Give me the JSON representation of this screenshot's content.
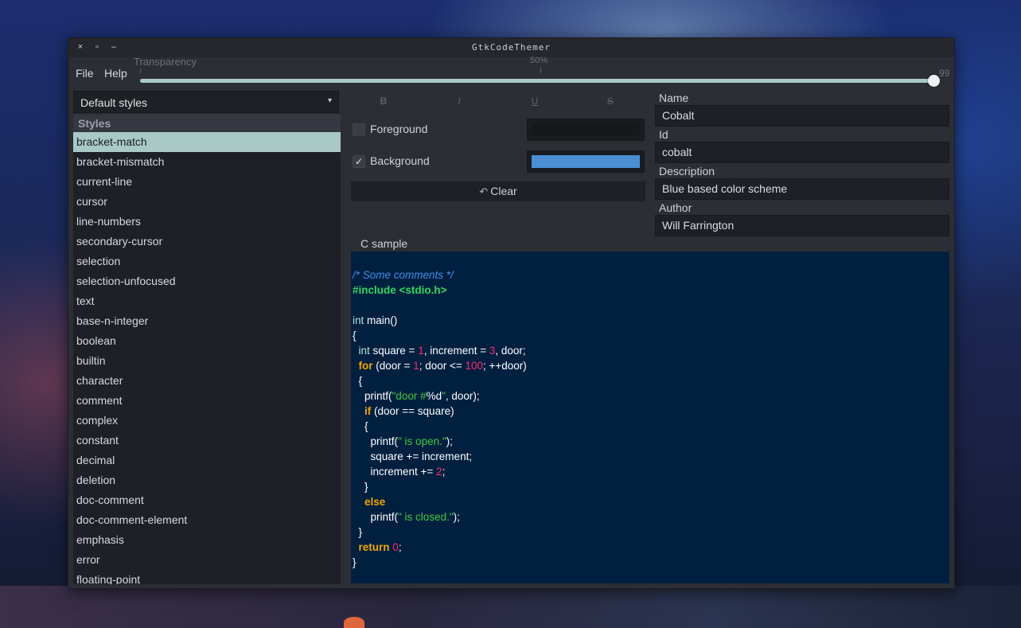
{
  "window": {
    "title": "GtkCodeThemer",
    "close": "×",
    "maximize": "▫",
    "minimize": "–"
  },
  "menu": {
    "file": "File",
    "help": "Help"
  },
  "transparency": {
    "label": "Transparency",
    "mark_label": "50%",
    "value": 99,
    "min": 0,
    "max": 99,
    "value_label": "99"
  },
  "styles_dropdown": {
    "selected": "Default styles",
    "chevron": "▾"
  },
  "styles_list": {
    "header": "Styles",
    "selected_index": 0,
    "items": [
      "bracket-match",
      "bracket-mismatch",
      "current-line",
      "cursor",
      "line-numbers",
      "secondary-cursor",
      "selection",
      "selection-unfocused",
      "text",
      "base-n-integer",
      "boolean",
      "builtin",
      "character",
      "comment",
      "complex",
      "constant",
      "decimal",
      "deletion",
      "doc-comment",
      "doc-comment-element",
      "emphasis",
      "error",
      "floating-point"
    ]
  },
  "format": {
    "bold": "B",
    "italic": "I",
    "underline": "U",
    "strike": "S"
  },
  "foreground": {
    "label": "Foreground",
    "checked": false,
    "check_mark": "",
    "color": "#16181b"
  },
  "background": {
    "label": "Background",
    "checked": true,
    "check_mark": "✓",
    "color": "#4a8ed4"
  },
  "clear": {
    "icon": "↶",
    "label": "Clear"
  },
  "fields": {
    "name": {
      "label": "Name",
      "value": "Cobalt"
    },
    "id": {
      "label": "Id",
      "value": "cobalt"
    },
    "description": {
      "label": "Description",
      "value": "Blue based color scheme"
    },
    "author": {
      "label": "Author",
      "value": "Will Farrington"
    }
  },
  "sample": {
    "tab": "C sample",
    "colors": {
      "comment": "#3c8fe8",
      "preproc": "#33d65e",
      "type": "#b4e4d0",
      "number": "#ff2a6d",
      "keyword": "#f5a300",
      "string": "#44c83c",
      "text": "#ffffff"
    },
    "lines": [
      [
        [
          "comment",
          "/* Some comments */"
        ]
      ],
      [
        [
          "preproc",
          "#include <stdio.h>"
        ]
      ],
      [],
      [
        [
          "type",
          "int"
        ],
        [
          "text",
          " main()"
        ]
      ],
      [
        [
          "text",
          "{"
        ]
      ],
      [
        [
          "text",
          "  "
        ],
        [
          "type",
          "int"
        ],
        [
          "text",
          " square = "
        ],
        [
          "number",
          "1"
        ],
        [
          "text",
          ", increment = "
        ],
        [
          "number",
          "3"
        ],
        [
          "text",
          ", door;"
        ]
      ],
      [
        [
          "text",
          "  "
        ],
        [
          "keyword",
          "for"
        ],
        [
          "text",
          " (door = "
        ],
        [
          "number",
          "1"
        ],
        [
          "text",
          "; door <= "
        ],
        [
          "number",
          "100"
        ],
        [
          "text",
          "; ++door)"
        ]
      ],
      [
        [
          "text",
          "  {"
        ]
      ],
      [
        [
          "text",
          "    printf("
        ],
        [
          "string",
          "\"door #"
        ],
        [
          "text",
          "%d"
        ],
        [
          "string",
          "\""
        ],
        [
          "text",
          ", door);"
        ]
      ],
      [
        [
          "text",
          "    "
        ],
        [
          "keyword",
          "if"
        ],
        [
          "text",
          " (door == square)"
        ]
      ],
      [
        [
          "text",
          "    {"
        ]
      ],
      [
        [
          "text",
          "      printf("
        ],
        [
          "string",
          "\" is open.\""
        ],
        [
          "text",
          ");"
        ]
      ],
      [
        [
          "text",
          "      square += increment;"
        ]
      ],
      [
        [
          "text",
          "      increment += "
        ],
        [
          "number",
          "2"
        ],
        [
          "text",
          ";"
        ]
      ],
      [
        [
          "text",
          "    }"
        ]
      ],
      [
        [
          "text",
          "    "
        ],
        [
          "keyword",
          "else"
        ]
      ],
      [
        [
          "text",
          "      printf("
        ],
        [
          "string",
          "\" is closed.\""
        ],
        [
          "text",
          ");"
        ]
      ],
      [
        [
          "text",
          "  }"
        ]
      ],
      [
        [
          "text",
          "  "
        ],
        [
          "keyword",
          "return"
        ],
        [
          "text",
          " "
        ],
        [
          "number",
          "0"
        ],
        [
          "text",
          ";"
        ]
      ],
      [
        [
          "text",
          "}"
        ]
      ]
    ]
  }
}
